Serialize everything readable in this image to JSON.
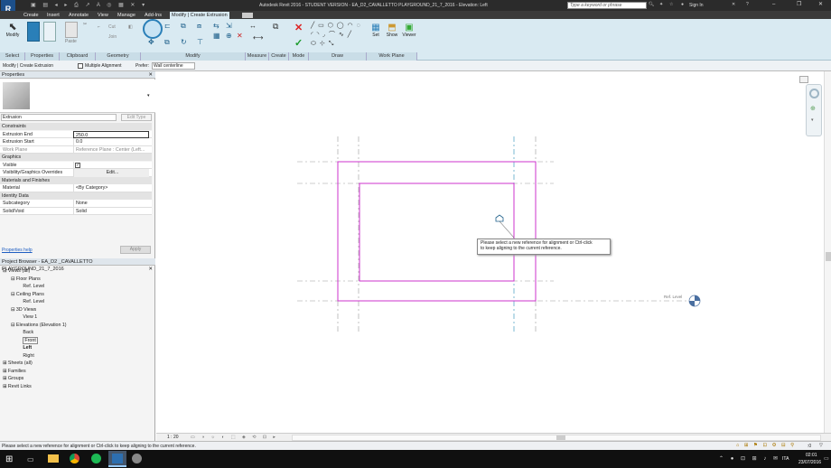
{
  "title": {
    "text": "Autodesk Revit 2016 -  STUDENT VERSION -    EA_D2_CAVALLETTO PLAYGROUND_21_7_2016 - Elevation: Left",
    "search_placeholder": "Type a keyword or phrase",
    "sign_in": "Sign In"
  },
  "tabs": [
    "Create",
    "Insert",
    "Annotate",
    "View",
    "Manage",
    "Add-Ins",
    "Modify | Create Extrusion"
  ],
  "ribbon": {
    "modify_label": "Modify",
    "cut": "Cut",
    "join": "Join",
    "set": "Set",
    "show": "Show",
    "viewer": "Viewer",
    "panels": [
      "Select",
      "Properties",
      "Clipboard",
      "Geometry",
      "Modify",
      "Measure",
      "Create",
      "Mode",
      "Draw",
      "Work Plane"
    ]
  },
  "options_bar": {
    "context": "Modify | Create Extrusion",
    "multiple_alignment": "Multiple Alignment",
    "prefer_label": "Prefer:",
    "prefer_value": "Wall centerline"
  },
  "properties": {
    "title": "Properties",
    "type": "Extrusion",
    "edit_type": "Edit Type",
    "groups": [
      {
        "name": "Constraints",
        "rows": [
          {
            "label": "Extrusion End",
            "value": "250.0"
          },
          {
            "label": "Extrusion Start",
            "value": "0.0"
          },
          {
            "label": "Work Plane",
            "value": "Reference Plane : Center (Left..."
          }
        ]
      },
      {
        "name": "Graphics",
        "rows": [
          {
            "label": "Visible",
            "value": ""
          },
          {
            "label": "Visibility/Graphics Overrides",
            "value": "Edit..."
          }
        ]
      },
      {
        "name": "Materials and Finishes",
        "rows": [
          {
            "label": "Material",
            "value": "<By Category>"
          }
        ]
      },
      {
        "name": "Identity Data",
        "rows": [
          {
            "label": "Subcategory",
            "value": "None"
          },
          {
            "label": "Solid/Void",
            "value": "Solid"
          }
        ]
      }
    ],
    "help": "Properties help",
    "apply": "Apply"
  },
  "browser": {
    "title": "Project Browser - EA_D2 _CAVALLETTO PLAYGROUND_21_7_2016",
    "items": [
      {
        "label": "Views (all)",
        "indent": 0,
        "bold": false
      },
      {
        "label": "Floor Plans",
        "indent": 1,
        "bold": false
      },
      {
        "label": "Ref. Level",
        "indent": 2,
        "bold": false
      },
      {
        "label": "Ceiling Plans",
        "indent": 1,
        "bold": false
      },
      {
        "label": "Ref. Level",
        "indent": 2,
        "bold": false
      },
      {
        "label": "3D Views",
        "indent": 1,
        "bold": false
      },
      {
        "label": "View 1",
        "indent": 2,
        "bold": false
      },
      {
        "label": "Elevations (Elevation 1)",
        "indent": 1,
        "bold": false
      },
      {
        "label": "Back",
        "indent": 2,
        "bold": false
      },
      {
        "label": "Front",
        "indent": 2,
        "bold": false
      },
      {
        "label": "Left",
        "indent": 2,
        "bold": true
      },
      {
        "label": "Right",
        "indent": 2,
        "bold": false
      },
      {
        "label": "Sheets (all)",
        "indent": 0,
        "bold": false
      },
      {
        "label": "Families",
        "indent": 0,
        "bold": false
      },
      {
        "label": "Groups",
        "indent": 0,
        "bold": false
      },
      {
        "label": "Revit Links",
        "indent": 0,
        "bold": false
      }
    ]
  },
  "canvas": {
    "tooltip_line1": "Please select a new reference for alignment or Ctrl-click",
    "tooltip_line2": "to keep aligning to the current reference.",
    "level_label": "Ref. Level",
    "scale": "1 : 20"
  },
  "status": {
    "text": "Please select a new reference for alignment or Ctrl-click to keep aligning to the current reference.",
    "zero": ":0"
  },
  "taskbar": {
    "lang": "ITA",
    "time": "02:01",
    "date": "23/07/2016"
  },
  "colors": {
    "sketch": "#cc33cc",
    "accent": "#2a7fb8"
  }
}
